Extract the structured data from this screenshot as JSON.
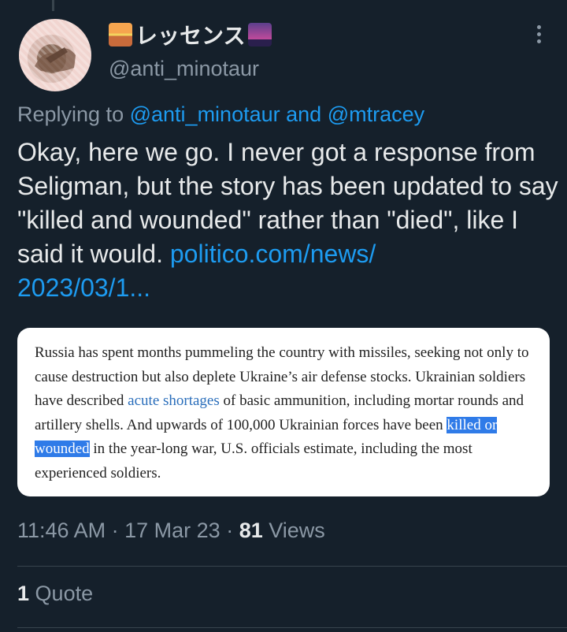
{
  "author": {
    "display_name": "レッセンス",
    "emoji_left": "sunrise-emoji",
    "emoji_right": "city-dusk-emoji",
    "handle": "@anti_minotaur"
  },
  "reply": {
    "prefix": "Replying to",
    "mention1": "@anti_minotaur",
    "joiner": "and",
    "mention2": "@mtracey"
  },
  "tweet": {
    "text": "Okay, here we go. I never got a response from Seligman, but the story has been updated to say \"killed and wounded\" rather than \"died\", like I said it would.",
    "link_line1": "politico.com/news/",
    "link_line2": "2023/03/1..."
  },
  "card": {
    "part1": "Russia has spent months pummeling the country with missiles, seeking not only to cause destruction but also deplete Ukraine’s air defense stocks. Ukrainian soldiers have described ",
    "link": "acute shortages",
    "part2": " of basic ammunition, including mortar rounds and artillery shells. And upwards of 100,000 Ukrainian forces have been ",
    "highlight": "killed or wounded",
    "part3": " in the year-long war, U.S. officials estimate, including the most experienced soldiers."
  },
  "meta": {
    "time": "11:46 AM",
    "date": "17 Mar 23",
    "views_count": "81",
    "views_label": "Views"
  },
  "engagement": {
    "quote_count": "1",
    "quote_label": "Quote"
  },
  "colors": {
    "background": "#15202b",
    "accent": "#1d9bf0",
    "secondary_text": "#8b98a5",
    "highlight": "#2f7be8"
  }
}
